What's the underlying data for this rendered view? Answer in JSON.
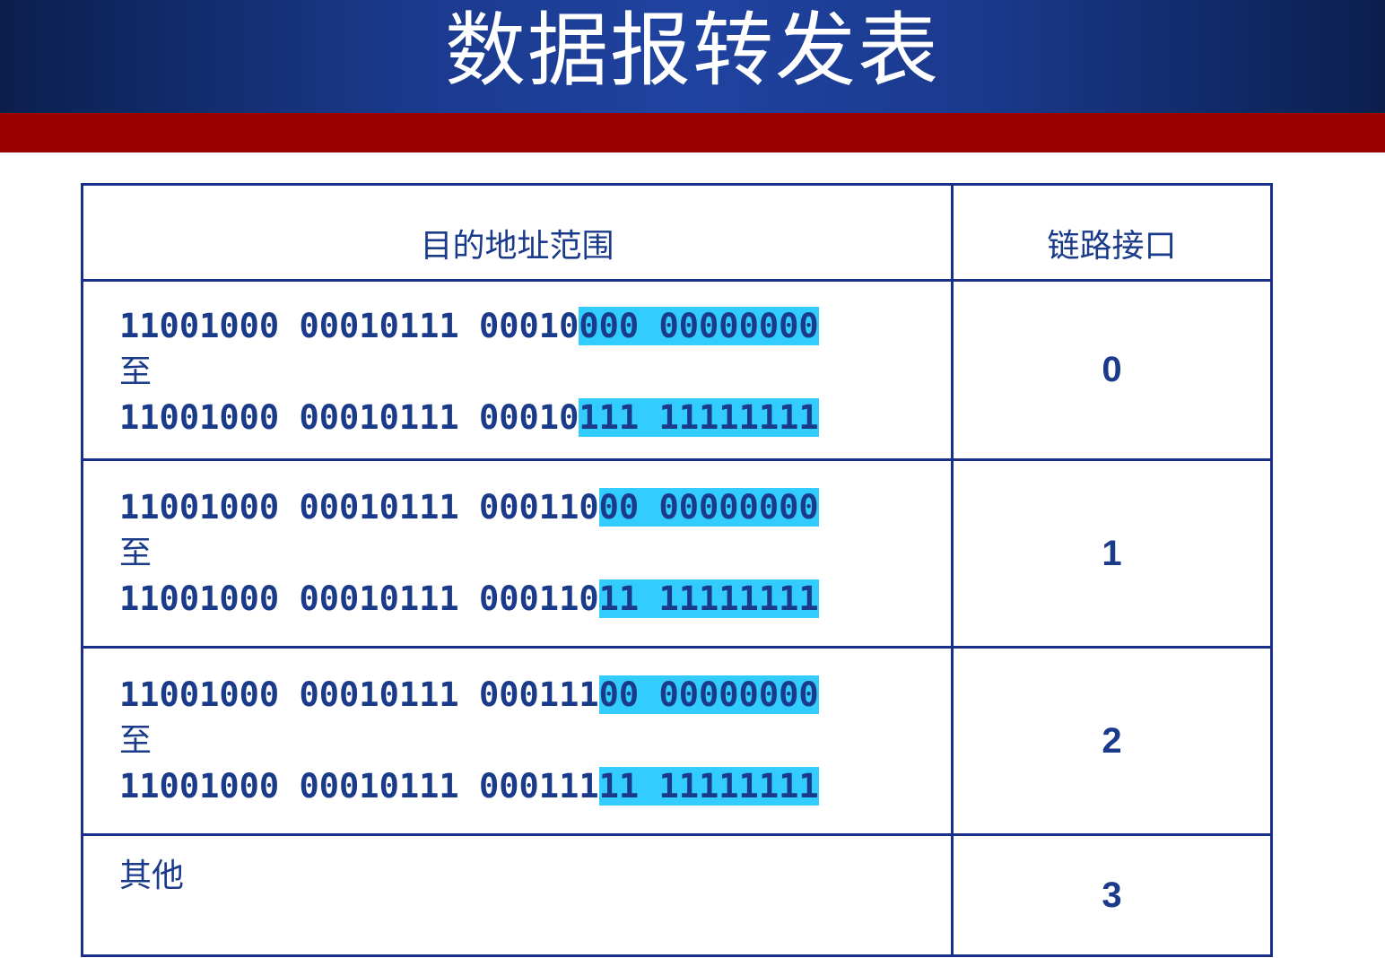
{
  "title": "数据报转发表",
  "table": {
    "headers": {
      "range": "目的地址范围",
      "interface": "链路接口"
    },
    "rows": [
      {
        "start_prefix": "11001000 00010111 00010",
        "start_suffix": "000 00000000",
        "to": "至",
        "end_prefix": "11001000 00010111 00010",
        "end_suffix": "111 11111111",
        "interface": "0"
      },
      {
        "start_prefix": "11001000 00010111 000110",
        "start_suffix": "00 00000000",
        "to": "至",
        "end_prefix": "11001000 00010111 000110",
        "end_suffix": "11 11111111",
        "interface": "1"
      },
      {
        "start_prefix": "11001000 00010111 000111",
        "start_suffix": "00 00000000",
        "to": "至",
        "end_prefix": "11001000 00010111 000111",
        "end_suffix": "11 11111111",
        "interface": "2"
      }
    ],
    "other": {
      "label": "其他",
      "interface": "3"
    }
  },
  "colors": {
    "title_bar": "#1b3a8e",
    "red_band": "#990000",
    "highlight": "#33ccff",
    "text": "#1a3a8a",
    "border": "#1a2f8a"
  }
}
